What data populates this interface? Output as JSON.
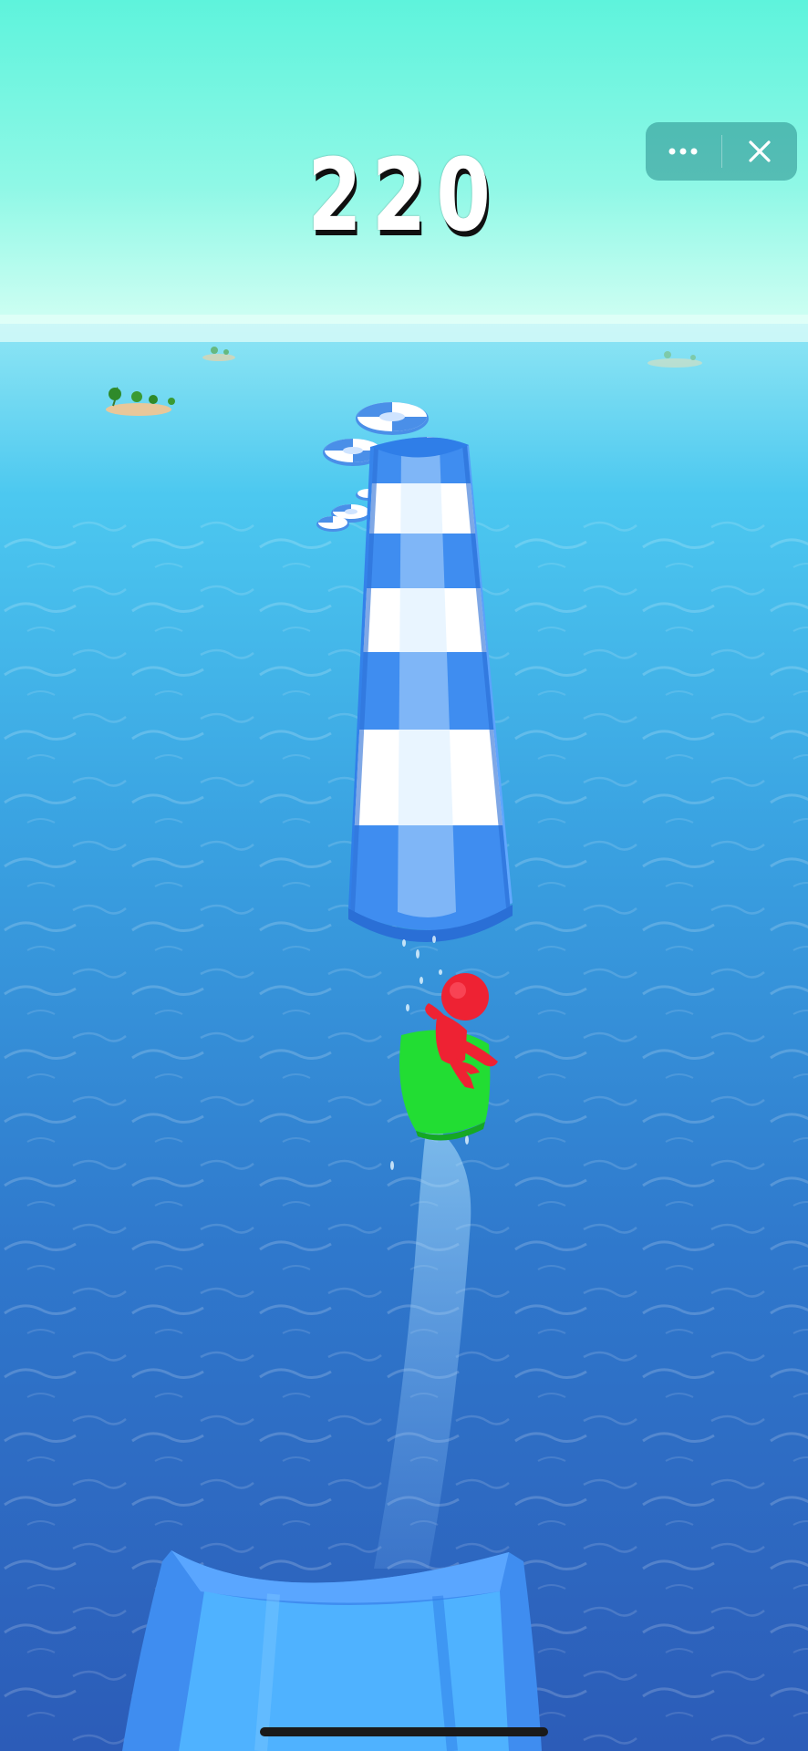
{
  "hud": {
    "score": "220"
  },
  "capsule": {
    "more_icon": "ellipsis-icon",
    "close_icon": "close-icon"
  },
  "colors": {
    "sky_top": "#5ef3dc",
    "sky_horizon": "#c9fff0",
    "sea_far": "#4cc8f0",
    "sea_near": "#2c5fba",
    "slide_blue": "#3f8df0",
    "slide_white": "#ffffff",
    "board_green": "#22dd33",
    "player_red": "#ee2233"
  }
}
